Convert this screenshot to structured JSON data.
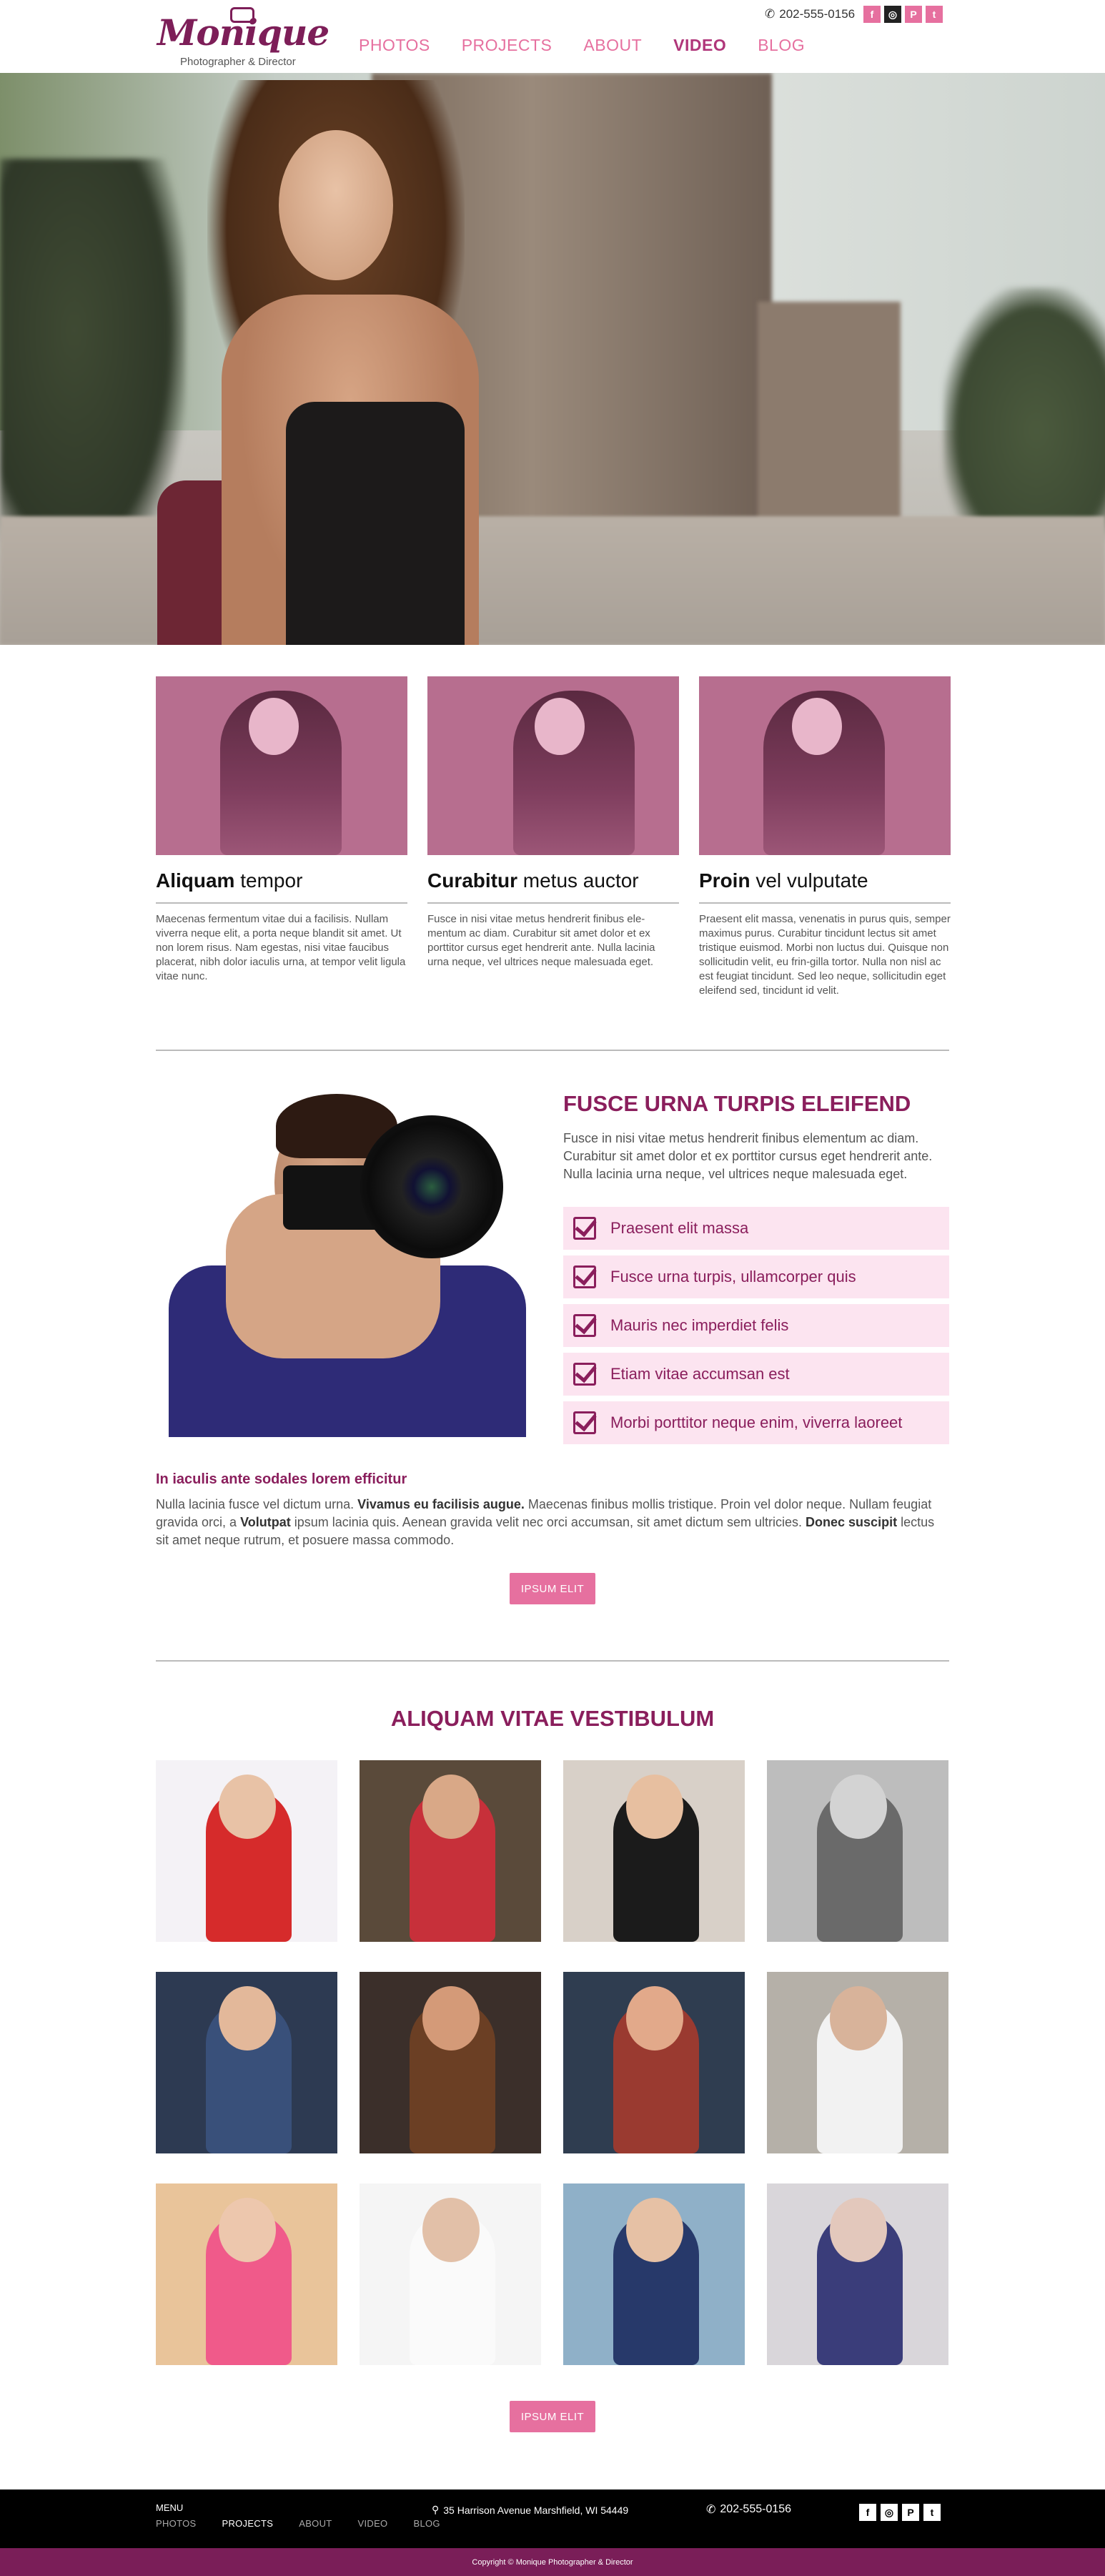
{
  "header": {
    "logo_text": "Monique",
    "logo_tagline": "Photographer & Director",
    "phone": "202-555-0156",
    "nav": [
      {
        "label": "PHOTOS"
      },
      {
        "label": "PROJECTS"
      },
      {
        "label": "ABOUT"
      },
      {
        "label": "VIDEO",
        "active": true
      },
      {
        "label": "BLOG"
      }
    ],
    "social": [
      "f",
      "◎",
      "P",
      "t"
    ]
  },
  "hero": {
    "slides": 3,
    "active_slide": 1
  },
  "cards": [
    {
      "title_bold": "Aliquam",
      "title_rest": " tempor",
      "text": "Maecenas fermentum vitae dui a facilisis. Nullam viverra neque elit, a porta neque blandit sit amet. Ut non lorem risus. Nam egestas, nisi vitae faucibus placerat, nibh dolor iaculis urna, at tempor velit ligula vitae nunc."
    },
    {
      "title_bold": "Curabitur",
      "title_rest": " metus auctor",
      "text": "Fusce in nisi vitae metus hendrerit finibus ele-mentum ac diam. Curabitur sit amet dolor et ex porttitor cursus eget hendrerit ante. Nulla lacinia urna neque, vel ultrices neque malesuada eget."
    },
    {
      "title_bold": "Proin",
      "title_rest": " vel vulputate",
      "text": "Praesent elit massa, venenatis in purus quis, semper maximus purus. Curabitur tincidunt lectus sit amet tristique euismod. Morbi non luctus dui. Quisque non sollicitudin velit, eu frin-gilla tortor. Nulla non nisl ac est feugiat tincidunt. Sed leo neque, sollicitudin eget eleifend sed, tincidunt id velit."
    }
  ],
  "feature": {
    "title": "FUSCE URNA TURPIS ELEIFEND",
    "text": "Fusce in nisi vitae metus hendrerit finibus elementum ac diam. Curabitur sit amet dolor et ex porttitor cursus eget hendrerit ante. Nulla lacinia urna neque, vel ultrices neque malesuada eget.",
    "checklist": [
      "Praesent elit massa",
      "Fusce urna turpis, ullamcorper quis",
      "Mauris nec imperdiet felis",
      "Etiam vitae accumsan est",
      "Morbi porttitor neque enim, viverra laoreet"
    ]
  },
  "about": {
    "subtitle": "In iaculis ante sodales lorem efficitur",
    "p1": "Nulla lacinia fusce vel dictum urna. ",
    "b1": "Vivamus eu facilisis augue.",
    "p2": " Maecenas finibus mollis tristique. Proin vel dolor neque. Nullam feugiat gravida orci, a ",
    "b2": "Volutpat",
    "p3": " ipsum lacinia quis. Aenean gravida velit nec orci accumsan, sit amet dictum sem ultricies. ",
    "b3": "Donec suscipit",
    "p4": " lectus sit amet neque rutrum, et posuere massa commodo.",
    "button": "IPSUM ELIT"
  },
  "gallery": {
    "title": "ALIQUAM VITAE VESTIBULUM",
    "button": "IPSUM ELIT"
  },
  "footer": {
    "menu_heading": "MENU",
    "menu": [
      {
        "label": "PHOTOS"
      },
      {
        "label": "PROJECTS",
        "active": true
      },
      {
        "label": "ABOUT"
      },
      {
        "label": "VIDEO"
      },
      {
        "label": "BLOG"
      }
    ],
    "address": "35 Harrison Avenue Marshfield, WI 54449",
    "phone": "202-555-0156",
    "social": [
      "f",
      "◎",
      "P",
      "t"
    ],
    "copyright": "Copyright © Monique Photographer & Director"
  },
  "colors": {
    "accent": "#e6709f",
    "brand": "#8a1e5c",
    "footer_bar": "#7a1e58"
  }
}
